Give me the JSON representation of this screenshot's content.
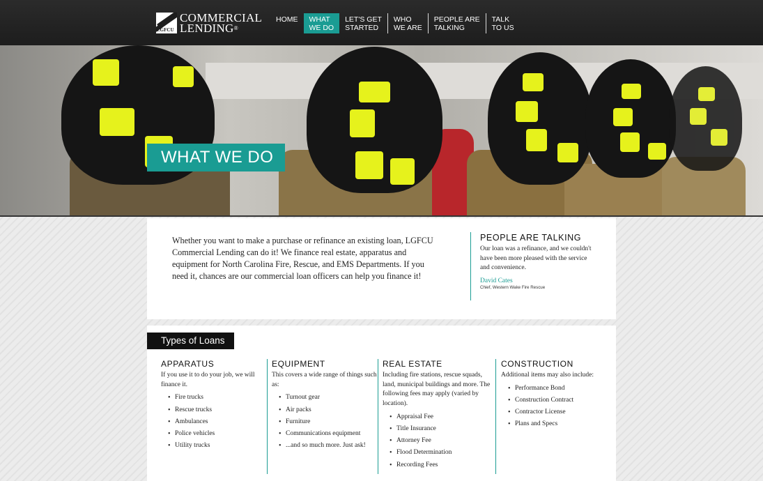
{
  "header": {
    "logo": {
      "mark": "LGFCU",
      "line1": "COMMERCIAL",
      "line2": "LENDING",
      "registered": "®"
    },
    "nav": [
      {
        "line1": "HOME",
        "line2": ""
      },
      {
        "line1": "WHAT",
        "line2": "WE DO"
      },
      {
        "line1": "LET'S GET",
        "line2": "STARTED"
      },
      {
        "line1": "WHO",
        "line2": "WE ARE"
      },
      {
        "line1": "PEOPLE ARE",
        "line2": "TALKING"
      },
      {
        "line1": "TALK",
        "line2": "TO US"
      }
    ],
    "active_nav": "WHAT WE DO"
  },
  "hero": {
    "title": "WHAT WE DO"
  },
  "intro": {
    "text": "Whether you want to make a purchase or refinance an existing loan, LGFCU Commercial Lending can do it! We finance real estate, apparatus and equipment for North Carolina Fire, Rescue, and EMS Departments. If you need it, chances are our commercial loan officers can help you finance it!"
  },
  "testimonial": {
    "title": "PEOPLE ARE TALKING",
    "quote": "Our loan was a refinance, and we couldn't have been more pleased with the service and convenience.",
    "name": "David Cates",
    "role": "Chief, Western Wake Fire Rescue"
  },
  "loans": {
    "title": "Types of Loans",
    "columns": [
      {
        "title": "APPARATUS",
        "description": "If you use it to do your job, we will finance it.",
        "items": [
          "Fire trucks",
          "Rescue trucks",
          "Ambulances",
          "Police vehicles",
          "Utility trucks"
        ]
      },
      {
        "title": "EQUIPMENT",
        "description": "This covers a wide range of things such as:",
        "items": [
          "Turnout gear",
          "Air packs",
          "Furniture",
          "Communications equipment",
          "...and so much more. Just ask!"
        ]
      },
      {
        "title": "REAL ESTATE",
        "description": "Including fire stations, rescue squads, land, municipal buildings and more. The following fees may apply (varied by location).",
        "items": [
          "Appraisal Fee",
          "Title Insurance",
          "Attorney Fee",
          "Flood Determination",
          "Recording Fees"
        ]
      },
      {
        "title": "CONSTRUCTION",
        "description": "Additional items may also include:",
        "items": [
          "Performance Bond",
          "Construction Contract",
          "Contractor License",
          "Plans and Specs"
        ]
      }
    ]
  },
  "colors": {
    "accent": "#1a9c93",
    "header_bg": "#222222",
    "helmet_stripe": "#e6f21c"
  }
}
